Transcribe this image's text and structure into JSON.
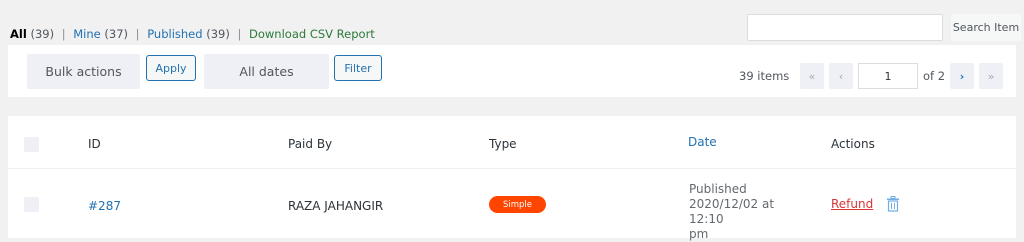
{
  "filters": {
    "all_label": "All",
    "all_count": "(39)",
    "mine_label": "Mine",
    "mine_count": "(37)",
    "published_label": "Published",
    "published_count": "(39)",
    "separator": "|",
    "csv_label": "Download CSV Report"
  },
  "search": {
    "placeholder": "",
    "button_label": "Search Item"
  },
  "tablenav": {
    "bulk_actions": "Bulk actions",
    "apply_label": "Apply",
    "date_filter": "All dates",
    "filter_label": "Filter",
    "items_count": "39 items",
    "first_page": "«",
    "prev_page": "‹",
    "current_page": "1",
    "of_pages": "of 2",
    "next_page": "›",
    "last_page": "»"
  },
  "table": {
    "columns": [
      "ID",
      "Paid By",
      "Type",
      "Date",
      "Actions"
    ],
    "rows": [
      {
        "id": "#287",
        "paid_by": "RAZA JAHANGIR",
        "type": "Simple",
        "date_status": "Published",
        "date_value": "2020/12/02 at 12:10",
        "date_tail": "pm",
        "action": "Refund"
      }
    ]
  },
  "colors": {
    "link": "#2271b1",
    "csv_link": "#2c7a3a",
    "badge": "#ff4500",
    "refund": "#d63638"
  },
  "icons": [
    "trash-icon"
  ]
}
